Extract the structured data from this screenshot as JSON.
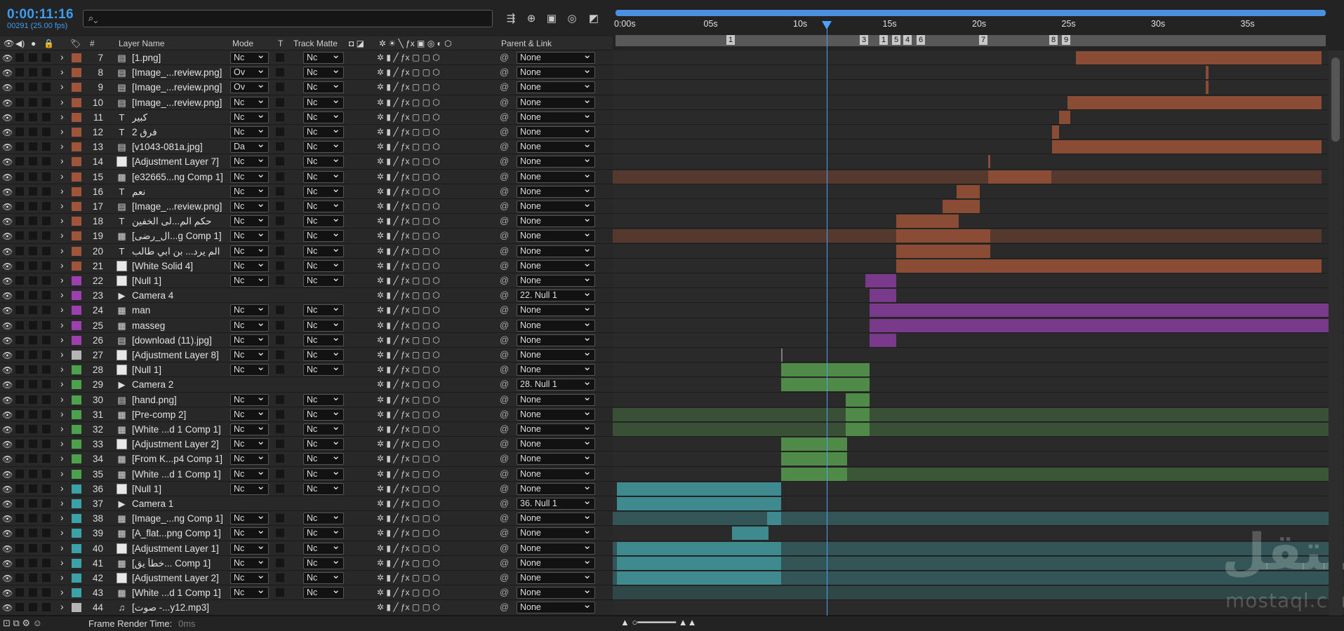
{
  "comp": {
    "timecode": "0:00:11:16",
    "frames": "00291 (25.00 fps)",
    "search_placeholder": ""
  },
  "columns": {
    "layer_name": "Layer Name",
    "mode": "Mode",
    "t": "T",
    "track_matte": "Track Matte",
    "parent": "Parent & Link",
    "hash": "#"
  },
  "ruler": {
    "ticks": [
      "0:00s",
      "05s",
      "10s",
      "15s",
      "20s",
      "25s",
      "30s",
      "35s"
    ],
    "markers": [
      "1",
      "3",
      "1",
      "5",
      "4",
      "6",
      "7",
      "8",
      "9"
    ]
  },
  "layers": [
    {
      "num": "7",
      "name": "[1.png]",
      "icon": "file",
      "label": "#a0553a",
      "mode": "Nc",
      "matte": "Nc",
      "parent": "None"
    },
    {
      "num": "8",
      "name": "[Image_...review.png]",
      "icon": "file",
      "label": "#a0553a",
      "mode": "Ov",
      "matte": "Nc",
      "parent": "None"
    },
    {
      "num": "9",
      "name": "[Image_...review.png]",
      "icon": "file",
      "label": "#a0553a",
      "mode": "Ov",
      "matte": "Nc",
      "parent": "None"
    },
    {
      "num": "10",
      "name": "[Image_...review.png]",
      "icon": "file",
      "label": "#a0553a",
      "mode": "Nc",
      "matte": "Nc",
      "parent": "None"
    },
    {
      "num": "11",
      "name": "كبير",
      "icon": "text",
      "label": "#a0553a",
      "mode": "Nc",
      "matte": "Nc",
      "parent": "None"
    },
    {
      "num": "12",
      "name": "فرق 2",
      "icon": "text",
      "label": "#a0553a",
      "mode": "Nc",
      "matte": "Nc",
      "parent": "None"
    },
    {
      "num": "13",
      "name": "[v1043-081a.jpg]",
      "icon": "file",
      "label": "#a0553a",
      "mode": "Da",
      "matte": "Nc",
      "parent": "None"
    },
    {
      "num": "14",
      "name": "[Adjustment Layer 7]",
      "icon": "solid",
      "label": "#a0553a",
      "mode": "Nc",
      "matte": "Nc",
      "parent": "None"
    },
    {
      "num": "15",
      "name": "[e32665...ng Comp 1]",
      "icon": "comp",
      "label": "#a0553a",
      "mode": "Nc",
      "matte": "Nc",
      "parent": "None"
    },
    {
      "num": "16",
      "name": "نعم",
      "icon": "text",
      "label": "#a0553a",
      "mode": "Nc",
      "matte": "Nc",
      "parent": "None"
    },
    {
      "num": "17",
      "name": "[Image_...review.png]",
      "icon": "file",
      "label": "#a0553a",
      "mode": "Nc",
      "matte": "Nc",
      "parent": "None"
    },
    {
      "num": "18",
      "name": "حكم الم...لى الخفين",
      "icon": "text",
      "label": "#a0553a",
      "mode": "Nc",
      "matte": "Nc",
      "parent": "None"
    },
    {
      "num": "19",
      "name": "[ال_رضى...g Comp 1]",
      "icon": "comp",
      "label": "#a0553a",
      "mode": "Nc",
      "matte": "Nc",
      "parent": "None"
    },
    {
      "num": "20",
      "name": "الم يرد... بن ابي طالب",
      "icon": "text",
      "label": "#a0553a",
      "mode": "Nc",
      "matte": "Nc",
      "parent": "None"
    },
    {
      "num": "21",
      "name": "[White Solid 4]",
      "icon": "solid",
      "label": "#a0553a",
      "mode": "Nc",
      "matte": "Nc",
      "parent": "None"
    },
    {
      "num": "22",
      "name": "[Null 1]",
      "icon": "solid",
      "label": "#9d3fae",
      "mode": "Nc",
      "matte": "Nc",
      "parent": "None"
    },
    {
      "num": "23",
      "name": "Camera 4",
      "icon": "camera",
      "label": "#9d3fae",
      "mode": "",
      "matte": "",
      "parent": "22. Null 1"
    },
    {
      "num": "24",
      "name": "man",
      "icon": "comp",
      "label": "#9d3fae",
      "mode": "Nc",
      "matte": "Nc",
      "parent": "None"
    },
    {
      "num": "25",
      "name": "masseg",
      "icon": "comp",
      "label": "#9d3fae",
      "mode": "Nc",
      "matte": "Nc",
      "parent": "None"
    },
    {
      "num": "26",
      "name": "[download (11).jpg]",
      "icon": "file",
      "label": "#9d3fae",
      "mode": "Nc",
      "matte": "Nc",
      "parent": "None"
    },
    {
      "num": "27",
      "name": "[Adjustment Layer 8]",
      "icon": "solid",
      "label": "#b5b5b5",
      "mode": "Nc",
      "matte": "Nc",
      "parent": "None"
    },
    {
      "num": "28",
      "name": "[Null 1]",
      "icon": "solid",
      "label": "#4ca24c",
      "mode": "Nc",
      "matte": "Nc",
      "parent": "None"
    },
    {
      "num": "29",
      "name": "Camera 2",
      "icon": "camera",
      "label": "#4ca24c",
      "mode": "",
      "matte": "",
      "parent": "28. Null 1"
    },
    {
      "num": "30",
      "name": "[hand.png]",
      "icon": "file",
      "label": "#4ca24c",
      "mode": "Nc",
      "matte": "Nc",
      "parent": "None"
    },
    {
      "num": "31",
      "name": "[Pre-comp 2]",
      "icon": "comp",
      "label": "#4ca24c",
      "mode": "Nc",
      "matte": "Nc",
      "parent": "None"
    },
    {
      "num": "32",
      "name": "[White ...d 1 Comp 1]",
      "icon": "comp",
      "label": "#4ca24c",
      "mode": "Nc",
      "matte": "Nc",
      "parent": "None"
    },
    {
      "num": "33",
      "name": "[Adjustment Layer 2]",
      "icon": "solid",
      "label": "#4ca24c",
      "mode": "Nc",
      "matte": "Nc",
      "parent": "None"
    },
    {
      "num": "34",
      "name": "[From K...p4 Comp 1]",
      "icon": "comp",
      "label": "#4ca24c",
      "mode": "Nc",
      "matte": "Nc",
      "parent": "None"
    },
    {
      "num": "35",
      "name": "[White ...d 1 Comp 1]",
      "icon": "comp",
      "label": "#4ca24c",
      "mode": "Nc",
      "matte": "Nc",
      "parent": "None"
    },
    {
      "num": "36",
      "name": "[Null 1]",
      "icon": "solid",
      "label": "#3ba3a8",
      "mode": "Nc",
      "matte": "Nc",
      "parent": "None"
    },
    {
      "num": "37",
      "name": "Camera 1",
      "icon": "camera",
      "label": "#3ba3a8",
      "mode": "",
      "matte": "",
      "parent": "36. Null 1"
    },
    {
      "num": "38",
      "name": "[Image_...ng Comp 1]",
      "icon": "comp",
      "label": "#3ba3a8",
      "mode": "Nc",
      "matte": "Nc",
      "parent": "None"
    },
    {
      "num": "39",
      "name": "[A_flat...png Comp 1]",
      "icon": "comp",
      "label": "#3ba3a8",
      "mode": "Nc",
      "matte": "Nc",
      "parent": "None"
    },
    {
      "num": "40",
      "name": "[Adjustment Layer 1]",
      "icon": "solid",
      "label": "#3ba3a8",
      "mode": "Nc",
      "matte": "Nc",
      "parent": "None"
    },
    {
      "num": "41",
      "name": "[خطأ يق... Comp 1]",
      "icon": "comp",
      "label": "#3ba3a8",
      "mode": "Nc",
      "matte": "Nc",
      "parent": "None"
    },
    {
      "num": "42",
      "name": "[Adjustment Layer 2]",
      "icon": "solid",
      "label": "#3ba3a8",
      "mode": "Nc",
      "matte": "Nc",
      "parent": "None"
    },
    {
      "num": "43",
      "name": "[White ...d 1 Comp 1]",
      "icon": "comp",
      "label": "#3ba3a8",
      "mode": "Nc",
      "matte": "Nc",
      "parent": "None"
    },
    {
      "num": "44",
      "name": "[صوت -...y12.mp3]",
      "icon": "audio",
      "label": "#b5b5b5",
      "mode": "",
      "matte": "",
      "parent": "None"
    }
  ],
  "status": {
    "frame_render_label": "Frame Render Time:",
    "frame_render_value": "0ms"
  },
  "watermark": {
    "text": "مستقل",
    "domain": "mostaql.com"
  }
}
